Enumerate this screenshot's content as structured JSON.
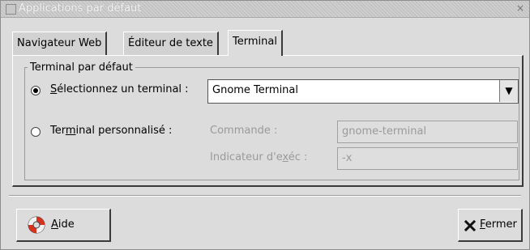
{
  "window": {
    "title": "Applications par défaut",
    "close_glyph": "×"
  },
  "tabs": [
    {
      "label": "Navigateur Web"
    },
    {
      "label": "Éditeur de texte"
    },
    {
      "label": "Terminal",
      "active": true
    }
  ],
  "group": {
    "label": "Terminal par défaut",
    "select_radio": {
      "pre": "",
      "mnemonic": "S",
      "post": "électionnez un terminal :",
      "checked": true
    },
    "terminal_combo": {
      "value": "Gnome Terminal",
      "arrow": "▼"
    },
    "custom_radio": {
      "pre": "Ter",
      "mnemonic": "m",
      "post": "inal personnalisé :",
      "checked": false
    },
    "command": {
      "label": "Commande :",
      "value": "gnome-terminal"
    },
    "exec_flag": {
      "label_pre": "Indicateur d'e",
      "mnemonic": "x",
      "label_post": "éc :",
      "value": "-x"
    }
  },
  "buttons": {
    "help": {
      "mnemonic": "A",
      "rest": "ide",
      "icon": "help-lifebuoy-icon"
    },
    "close": {
      "mnemonic": "F",
      "rest": "ermer",
      "icon": "close-x-icon"
    }
  }
}
